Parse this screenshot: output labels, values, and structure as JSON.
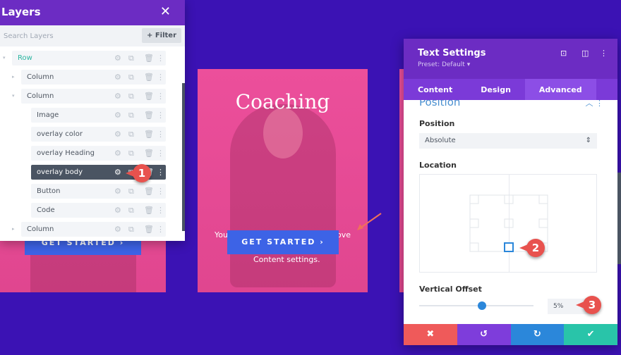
{
  "canvas": {
    "card_title": "Coaching",
    "cta_label": "GET STARTED",
    "cta_arrow": "›",
    "body_left": "You",
    "body_right": "ove",
    "body_bottom": "Content settings."
  },
  "layers": {
    "title": "Layers",
    "close": "✕",
    "search_placeholder": "Search Layers",
    "filter_label": "+ Filter",
    "items": [
      {
        "label": "Row"
      },
      {
        "label": "Column"
      },
      {
        "label": "Column"
      },
      {
        "label": "Image"
      },
      {
        "label": "overlay color"
      },
      {
        "label": "overlay Heading"
      },
      {
        "label": "overlay body"
      },
      {
        "label": "Button"
      },
      {
        "label": "Code"
      },
      {
        "label": "Column"
      }
    ]
  },
  "settings": {
    "title": "Text Settings",
    "preset": "Preset: Default ▾",
    "tabs": [
      "Content",
      "Design",
      "Advanced"
    ],
    "active_tab": "Advanced",
    "section": "Position",
    "position_label": "Position",
    "position_value": "Absolute",
    "location_label": "Location",
    "location_selected": "bottom-center",
    "offset_label": "Vertical Offset",
    "offset_value": "5%",
    "offset_fraction": 0.55
  },
  "badges": [
    "1",
    "2",
    "3"
  ],
  "colors": {
    "background": "#3b12b4",
    "header": "#6c2cc3",
    "cancel": "#ef5a5a",
    "undo": "#7e3ddb",
    "redo": "#2b87da",
    "save": "#29c4a9"
  }
}
